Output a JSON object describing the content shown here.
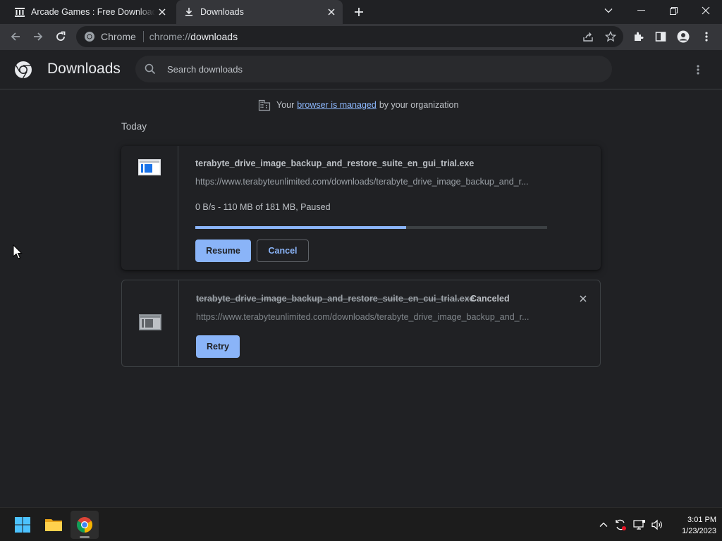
{
  "tabs": [
    {
      "title": "Arcade Games : Free Download, Borrow and Streaming : Internet Archive",
      "icon": "archive-icon",
      "active": false
    },
    {
      "title": "Downloads",
      "icon": "download-icon",
      "active": true
    }
  ],
  "omnibox": {
    "site_label": "Chrome",
    "url_scheme": "chrome://",
    "url_host": "downloads"
  },
  "page": {
    "title": "Downloads",
    "search_placeholder": "Search downloads",
    "managed_prefix": "Your",
    "managed_link": "browser is managed",
    "managed_suffix": "by your organization",
    "section_label": "Today"
  },
  "downloads": [
    {
      "filename": "terabyte_drive_image_backup_and_restore_suite_en_gui_trial.exe",
      "url": "https://www.terabyteunlimited.com/downloads/terabyte_drive_image_backup_and_r...",
      "status": "0 B/s - 110 MB of 181 MB, Paused",
      "progress": 0.6,
      "buttons": {
        "resume": "Resume",
        "cancel": "Cancel"
      }
    },
    {
      "filename": "terabyte_drive_image_backup_and_restore_suite_en_cui_trial.exe",
      "state": "Canceled",
      "url": "https://www.terabyteunlimited.com/downloads/terabyte_drive_image_backup_and_r...",
      "buttons": {
        "retry": "Retry"
      }
    }
  ],
  "taskbar": {
    "time": "3:01 PM",
    "date": "1/23/2023"
  },
  "colors": {
    "accent": "#8ab4f8",
    "background": "#202124",
    "toolbar": "#35363a"
  }
}
